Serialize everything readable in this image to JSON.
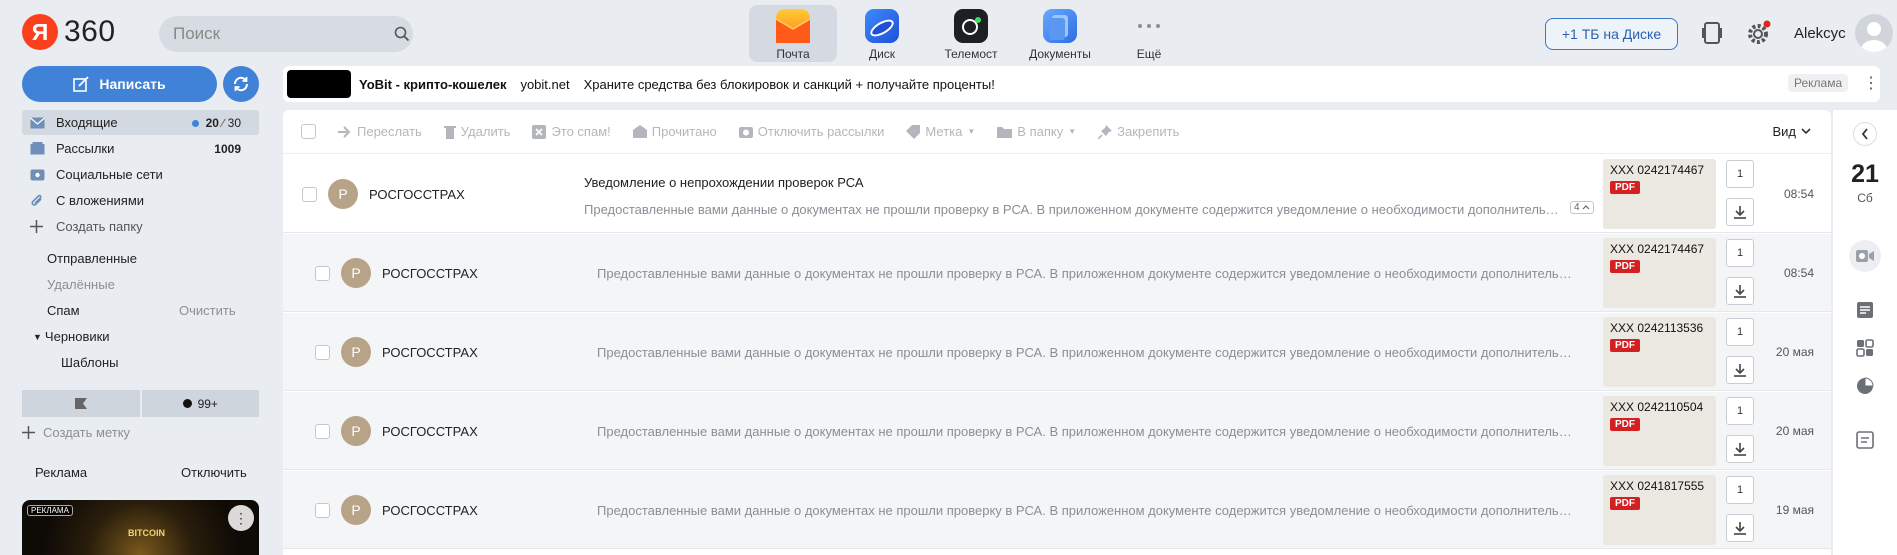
{
  "topbar": {
    "logo_letter": "Я",
    "logo_text": "360",
    "search_placeholder": "Поиск",
    "apps": [
      {
        "label": "Почта"
      },
      {
        "label": "Диск"
      },
      {
        "label": "Телемост"
      },
      {
        "label": "Документы"
      },
      {
        "label": "Ещё"
      }
    ],
    "disk_button": "+1 ТБ на Диске",
    "username": "Alekcyc"
  },
  "sidebar": {
    "compose_label": "Написать",
    "folders": [
      {
        "label": "Входящие",
        "unread": "20",
        "total": "30"
      },
      {
        "label": "Рассылки",
        "count": "1009"
      },
      {
        "label": "Социальные сети"
      },
      {
        "label": "С вложениями"
      },
      {
        "label": "Создать папку"
      }
    ],
    "sent": "Отправленные",
    "deleted": "Удалённые",
    "spam": "Спам",
    "clean": "Очистить",
    "drafts": "Черновики",
    "templates": "Шаблоны",
    "filter_unread_count": "99+",
    "create_label": "Создать метку",
    "ad_label": "Реклама",
    "ad_off": "Отключить",
    "ad_tag": "РЕКЛАМА",
    "ad_bitcoin": "BITCOIN"
  },
  "banner": {
    "title": "YoBit - крипто-кошелек",
    "domain": "yobit.net",
    "text": "Храните средства без блокировок и санкций + получайте проценты!",
    "tag": "Реклама"
  },
  "toolbar": {
    "forward": "Переслать",
    "delete": "Удалить",
    "spam": "Это спам!",
    "read": "Прочитано",
    "unsubscribe": "Отключить рассылки",
    "label": "Метка",
    "to_folder": "В папку",
    "pin": "Закрепить",
    "view": "Вид"
  },
  "messages": [
    {
      "initial": "Р",
      "sender": "РОСГОССТРАХ",
      "subject": "Уведомление о непрохождении проверок РСА",
      "snippet": "Предоставленные вами данные о документах не прошли проверку в РСА. В приложенном документе содержится уведомление о необходимости дополнитель…",
      "thread_count": "4",
      "attach_name": "XXX 0242174467",
      "attach_count": "1",
      "date": "08:54"
    },
    {
      "initial": "Р",
      "sender": "РОСГОССТРАХ",
      "snippet": "Предоставленные вами данные о документах не прошли проверку в РСА. В приложенном документе содержится уведомление о необходимости дополнительног…",
      "attach_name": "XXX 0242174467",
      "attach_count": "1",
      "date": "08:54"
    },
    {
      "initial": "Р",
      "sender": "РОСГОССТРАХ",
      "snippet": "Предоставленные вами данные о документах не прошли проверку в РСА. В приложенном документе содержится уведомление о необходимости дополнительног…",
      "attach_name": "XXX 0242113536",
      "attach_count": "1",
      "date": "20 мая"
    },
    {
      "initial": "Р",
      "sender": "РОСГОССТРАХ",
      "snippet": "Предоставленные вами данные о документах не прошли проверку в РСА. В приложенном документе содержится уведомление о необходимости дополнительног…",
      "attach_name": "XXX 0242110504",
      "attach_count": "1",
      "date": "20 мая"
    },
    {
      "initial": "Р",
      "sender": "РОСГОССТРАХ",
      "snippet": "Предоставленные вами данные о документах не прошли проверку в РСА. В приложенном документе содержится уведомление о необходимости дополнительног…",
      "attach_name": "XXX 0241817555",
      "attach_count": "1",
      "date": "19 мая"
    }
  ],
  "pdf_label": "PDF",
  "right_panel": {
    "day": "21",
    "weekday": "Сб"
  },
  "colors": {
    "accent": "#3f82d8",
    "brand_red": "#fc3f1d",
    "pdf_red": "#d42020"
  }
}
